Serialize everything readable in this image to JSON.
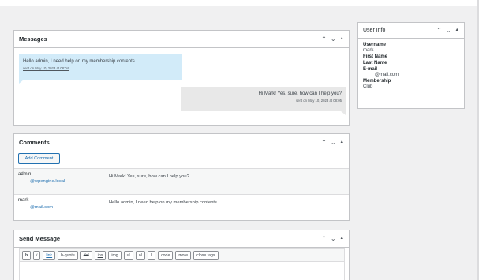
{
  "messages_box": {
    "title": "Messages",
    "messages": [
      {
        "text": "Hello admin, I need help on my membership contents.",
        "date": "sent on May 10, 2023 at 08:04"
      },
      {
        "text": "Hi Mark! Yes, sure, how can I help you?",
        "date": "sent on May 10, 2023 at 08:05"
      }
    ]
  },
  "comments_box": {
    "title": "Comments",
    "add_comment_label": "Add Comment",
    "rows": [
      {
        "author": "admin",
        "email": "@wpengine.local",
        "text": "Hi Mark! Yes, sure, how can I help you?"
      },
      {
        "author": "mark",
        "email": "@mail.com",
        "text": "Hello admin, I need help on my membership contents."
      }
    ]
  },
  "send_box": {
    "title": "Send Message",
    "buttons": [
      "b",
      "i",
      "link",
      "b-quote",
      "del",
      "ins",
      "img",
      "ul",
      "ol",
      "li",
      "code",
      "more",
      "close tags"
    ]
  },
  "user_info": {
    "title": "User Info",
    "username_label": "Username",
    "username": "mark",
    "first_name_label": "First Name",
    "last_name_label": "Last Name",
    "email_label": "E-mail",
    "email": "@mail.com",
    "membership_label": "Membership",
    "membership": "Club"
  },
  "icons": {
    "collapse_up": "chevron-up-icon",
    "collapse_down": "chevron-down-icon",
    "toggle": "triangle-up-icon"
  }
}
